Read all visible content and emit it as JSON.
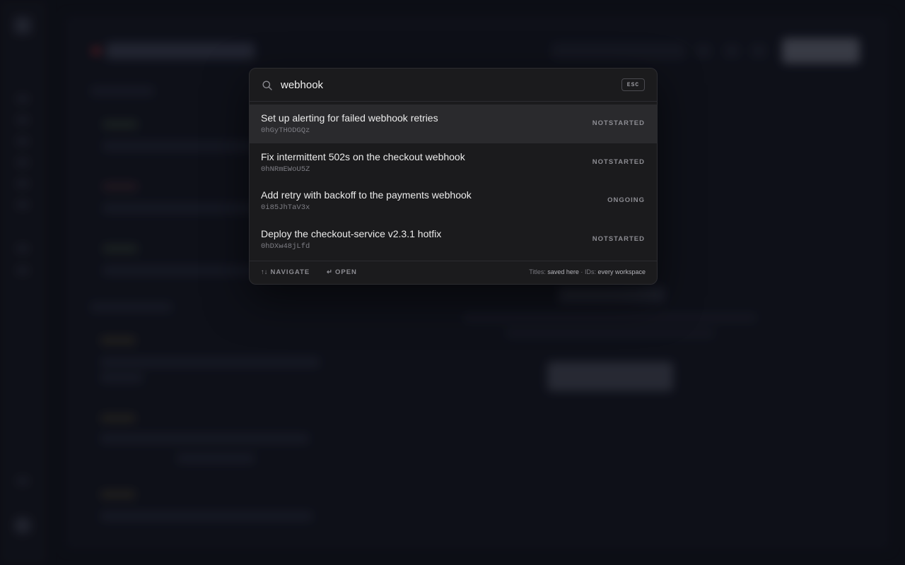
{
  "search": {
    "value": "webhook",
    "esc_label": "ESC"
  },
  "results": [
    {
      "title": "Set up alerting for failed webhook retries",
      "id": "0hGyTHODGQz",
      "status": "NOTSTARTED",
      "active": true
    },
    {
      "title": "Fix intermittent 502s on the checkout webhook",
      "id": "0hNRmEWoU5Z",
      "status": "NOTSTARTED",
      "active": false
    },
    {
      "title": "Add retry with backoff to the payments webhook",
      "id": "0i85JhTaV3x",
      "status": "ONGOING",
      "active": false
    },
    {
      "title": "Deploy the checkout-service v2.3.1 hotfix",
      "id": "0hDXw48jLfd",
      "status": "NOTSTARTED",
      "active": false
    }
  ],
  "footer": {
    "navigate_glyph": "↑↓",
    "navigate_label": "NAVIGATE",
    "open_glyph": "↵",
    "open_label": "OPEN",
    "scope_titles_label": "Titles:",
    "scope_titles_value": "saved here",
    "scope_separator": "·",
    "scope_ids_label": "IDs:",
    "scope_ids_value": "every workspace"
  },
  "icons": {
    "search": "search-icon"
  },
  "colors": {
    "palette_bg": "#1b1b1d",
    "active_row_bg": "#2a2a2d",
    "backdrop": "#0f1117"
  }
}
